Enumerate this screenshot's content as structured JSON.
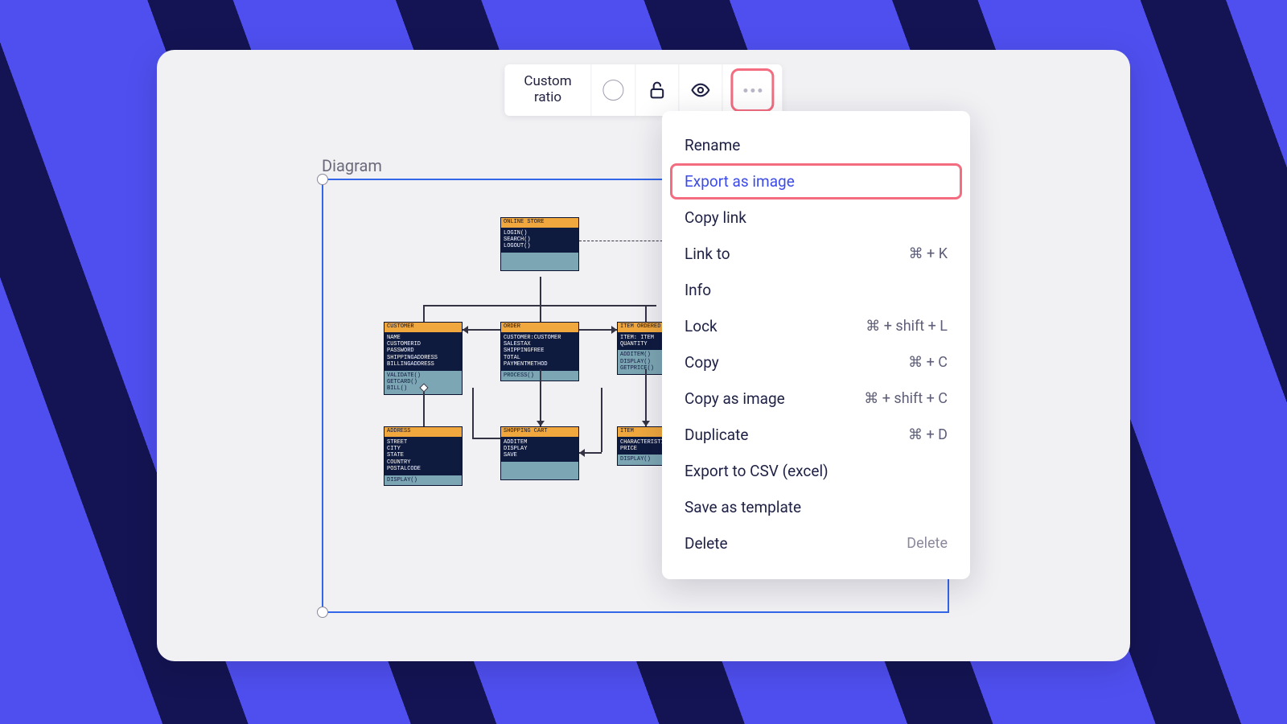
{
  "background": {
    "primary": "#4F4FF0",
    "stripe": "#141454"
  },
  "toolbar": {
    "custom_ratio_label_line1": "Custom",
    "custom_ratio_label_line2": "ratio"
  },
  "diagram": {
    "label": "Diagram",
    "boxes": {
      "store": {
        "title": "ONLINE STORE",
        "attrs": "LOGIN()\nSEARCH()\nLOGOUT()",
        "ops": " "
      },
      "customer": {
        "title": "CUSTOMER",
        "attrs": "NAME\nCUSTOMERID\nPASSWORD\nSHIPPINGADDRESS\nBILLINGADDRESS",
        "ops": "VALIDATE()\nGETCARD()\nBILL()"
      },
      "order": {
        "title": "ORDER",
        "attrs": "CUSTOMER:CUSTOMER\nSALESTAX\nSHIPPINGFREE\nTOTAL\nPAYMENTMETHOD",
        "ops": "PROCESS()"
      },
      "ordered": {
        "title": "ITEM ORDERED",
        "attrs": "ITEM: ITEM\nQUANTITY",
        "ops": "ADDITEM()\nDISPLAY()\nGETPRICE()"
      },
      "address": {
        "title": "ADDRESS",
        "attrs": "STREET\nCITY\nSTATE\nCOUNTRY\nPOSTALCODE",
        "ops": "DISPLAY()"
      },
      "cart": {
        "title": "SHOPPING CART",
        "attrs": "ADDITEM\nDISPLAY\nSAVE",
        "ops": " "
      },
      "item": {
        "title": "ITEM",
        "attrs": "CHARACTERISTICS\nPRICE",
        "ops": "DISPLAY()"
      }
    }
  },
  "menu": {
    "items": [
      {
        "label": "Rename",
        "shortcut": ""
      },
      {
        "label": "Export as image",
        "shortcut": ""
      },
      {
        "label": "Copy link",
        "shortcut": ""
      },
      {
        "label": "Link to",
        "shortcut": "⌘ + K"
      },
      {
        "label": "Info",
        "shortcut": ""
      },
      {
        "label": "Lock",
        "shortcut": "⌘ + shift + L"
      },
      {
        "label": "Copy",
        "shortcut": "⌘ + C"
      },
      {
        "label": "Copy as image",
        "shortcut": "⌘ + shift + C"
      },
      {
        "label": "Duplicate",
        "shortcut": "⌘ + D"
      },
      {
        "label": "Export to CSV (excel)",
        "shortcut": ""
      },
      {
        "label": "Save as template",
        "shortcut": ""
      },
      {
        "label": "Delete",
        "shortcut": "Delete"
      }
    ]
  }
}
